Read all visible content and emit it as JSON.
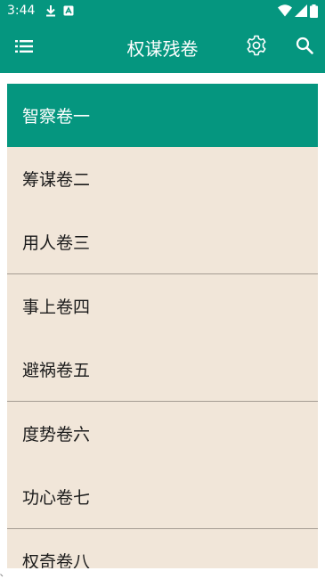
{
  "status_bar": {
    "time": "3:44",
    "icons": [
      "download-icon",
      "app-notification-icon",
      "wifi-icon",
      "signal-icon",
      "battery-icon"
    ]
  },
  "app_bar": {
    "title": "权谋残卷",
    "menu_icon": "menu-icon",
    "settings_icon": "gear-icon",
    "search_icon": "search-icon"
  },
  "colors": {
    "primary": "#05967f",
    "list_background": "#f1e6d9",
    "divider": "#a49c92",
    "text": "#1b1b1b",
    "selected_text": "#ffffff"
  },
  "chapters": [
    {
      "label": "智察卷一",
      "selected": true
    },
    {
      "label": "筹谋卷二",
      "selected": false
    },
    {
      "label": "用人卷三",
      "selected": false
    },
    {
      "label": "事上卷四",
      "selected": false
    },
    {
      "label": "避祸卷五",
      "selected": false
    },
    {
      "label": "度势卷六",
      "selected": false
    },
    {
      "label": "功心卷七",
      "selected": false
    },
    {
      "label": "权奇卷八",
      "selected": false
    }
  ]
}
